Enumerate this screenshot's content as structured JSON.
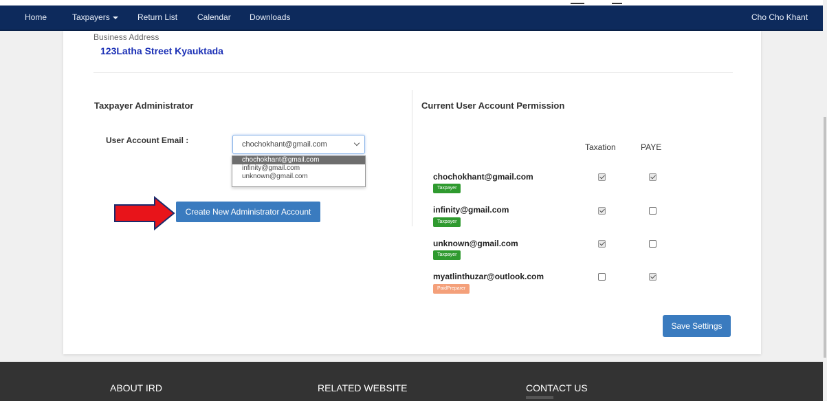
{
  "navbar": {
    "items": [
      {
        "label": "Home"
      },
      {
        "label": "Taxpayers"
      },
      {
        "label": "Return List"
      },
      {
        "label": "Calendar"
      },
      {
        "label": "Downloads"
      }
    ],
    "user": "Cho Cho Khant"
  },
  "business": {
    "label": "Business Address",
    "value": "123Latha Street Kyauktada"
  },
  "admin": {
    "title": "Taxpayer Administrator",
    "email_label": "User Account Email :",
    "selected": "chochokhant@gmail.com",
    "options": [
      "chochokhant@gmail.com",
      "infinity@gmail.com",
      "unknown@gmail.com"
    ],
    "create_button": "Create New Administrator Account"
  },
  "permissions": {
    "title": "Current User Account Permission",
    "columns": [
      "Taxation",
      "PAYE"
    ],
    "rows": [
      {
        "email": "chochokhant@gmail.com",
        "role": "Taxpayer",
        "taxation": true,
        "paye": true
      },
      {
        "email": "infinity@gmail.com",
        "role": "Taxpayer",
        "taxation": true,
        "paye": false
      },
      {
        "email": "unknown@gmail.com",
        "role": "Taxpayer",
        "taxation": true,
        "paye": false
      },
      {
        "email": "myatlinthuzar@outlook.com",
        "role": "PaidPreparer",
        "taxation": false,
        "paye": true
      }
    ],
    "save_button": "Save Settings"
  },
  "footer": {
    "about": "ABOUT IRD",
    "related": "RELATED WEBSITE",
    "contact": "CONTACT US"
  },
  "colors": {
    "navbar": "#0d2a5c",
    "primary_button": "#3a7bbf",
    "badge_taxpayer": "#2f9a2f",
    "badge_preparer": "#f4a07a",
    "arrow": "#e8141a",
    "footer": "#333333"
  }
}
